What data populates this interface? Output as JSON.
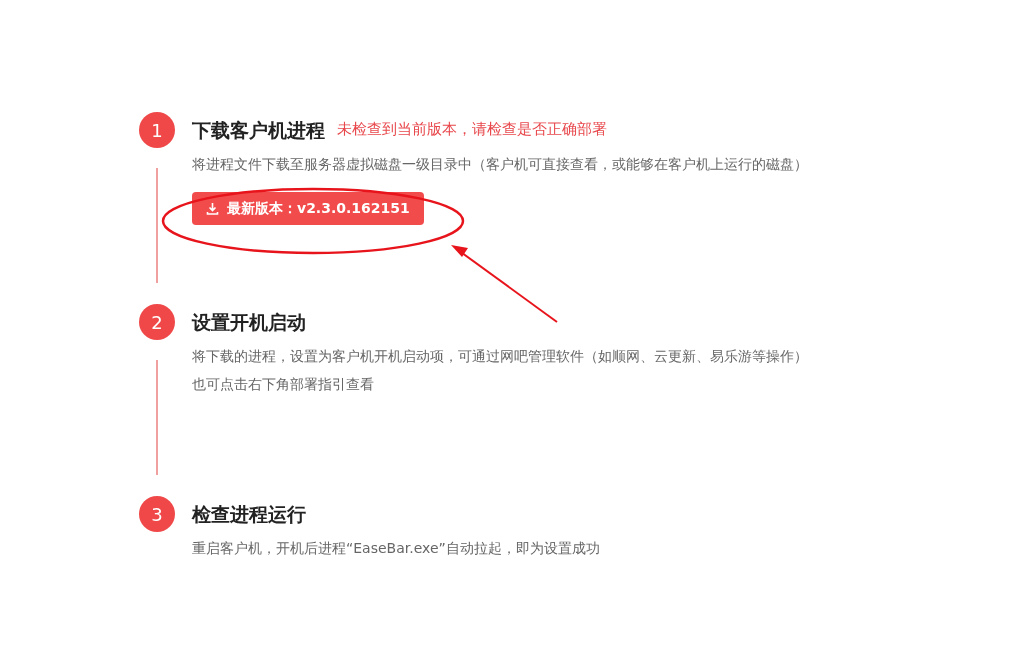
{
  "steps": [
    {
      "number": "1",
      "title": "下载客户机进程",
      "warning": "未检查到当前版本，请检查是否正确部署",
      "description": "将进程文件下载至服务器虚拟磁盘一级目录中（客户机可直接查看，或能够在客户机上运行的磁盘）",
      "button": "最新版本：v2.3.0.162151"
    },
    {
      "number": "2",
      "title": "设置开机启动",
      "description": "将下载的进程，设置为客户机开机启动项，可通过网吧管理软件（如顺网、云更新、易乐游等操作）",
      "note": "也可点击右下角部署指引查看"
    },
    {
      "number": "3",
      "title": "检查进程运行",
      "description": "重启客户机，开机后进程“EaseBar.exe”自动拉起，即为设置成功"
    }
  ]
}
